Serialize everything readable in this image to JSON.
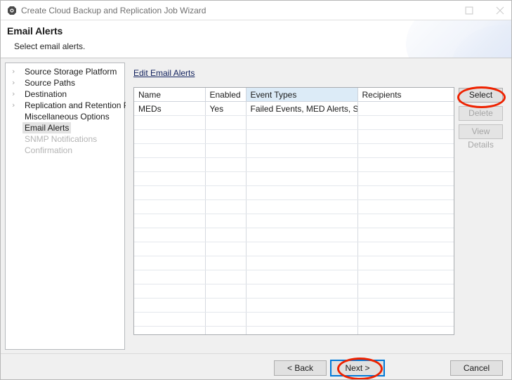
{
  "window": {
    "title": "Create Cloud Backup and Replication Job Wizard",
    "app_icon": "gear-icon",
    "controls": {
      "maximize": "maximize-icon",
      "close": "close-icon"
    }
  },
  "header": {
    "title": "Email Alerts",
    "subtitle": "Select email alerts."
  },
  "sidebar": {
    "items": [
      {
        "label": "Source Storage Platform",
        "chevron": "›",
        "state": "normal"
      },
      {
        "label": "Source Paths",
        "chevron": "›",
        "state": "normal"
      },
      {
        "label": "Destination",
        "chevron": "›",
        "state": "normal"
      },
      {
        "label": "Replication and Retention Policy",
        "chevron": "›",
        "state": "normal"
      },
      {
        "label": "Miscellaneous Options",
        "chevron": "",
        "state": "normal"
      },
      {
        "label": "Email Alerts",
        "chevron": "",
        "state": "selected"
      },
      {
        "label": "SNMP Notifications",
        "chevron": "",
        "state": "disabled"
      },
      {
        "label": "Confirmation",
        "chevron": "",
        "state": "disabled"
      }
    ]
  },
  "main": {
    "edit_link": "Edit Email Alerts",
    "table": {
      "columns": [
        {
          "label": "Name",
          "highlighted": false
        },
        {
          "label": "Enabled",
          "highlighted": false
        },
        {
          "label": "Event Types",
          "highlighted": true
        },
        {
          "label": "Recipients",
          "highlighted": false
        }
      ],
      "rows": [
        {
          "name": "MEDs",
          "enabled": "Yes",
          "event_types": "Failed Events, MED Alerts, Sca...",
          "recipients": ""
        }
      ],
      "empty_row_count": 16
    },
    "side_buttons": [
      {
        "label": "Select",
        "enabled": true,
        "annotated": true
      },
      {
        "label": "Delete",
        "enabled": false,
        "annotated": false
      },
      {
        "label": "View Details",
        "enabled": false,
        "annotated": false
      }
    ]
  },
  "footer": {
    "back": "< Back",
    "next": "Next >",
    "cancel": "Cancel"
  },
  "colors": {
    "link": "#10205c",
    "header_highlight": "#dcebf7",
    "annotation": "#ee2200",
    "focus": "#0078d7"
  }
}
